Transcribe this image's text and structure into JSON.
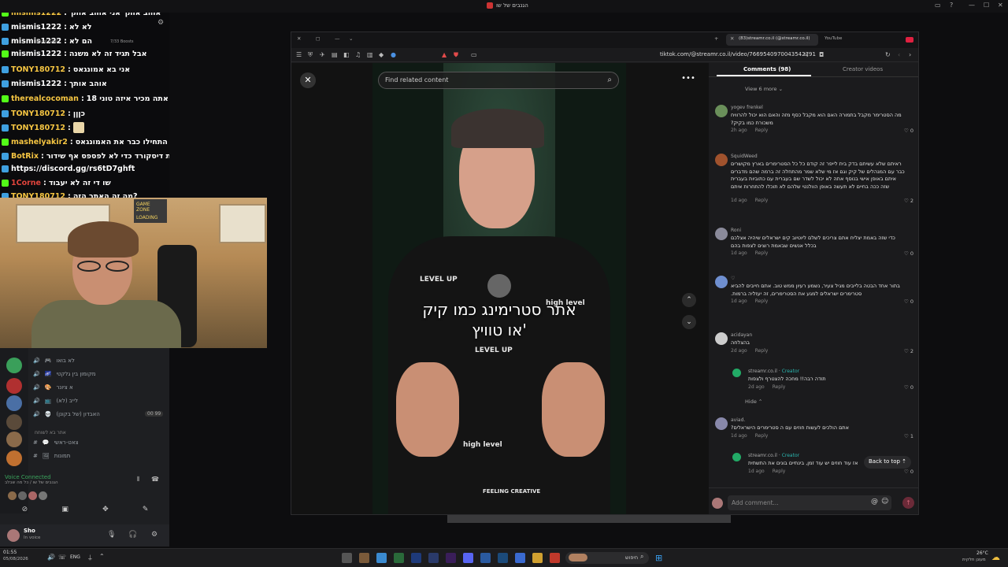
{
  "window": {
    "title": "הגנבים של שו"
  },
  "chat": {
    "messages": [
      {
        "nick": "mismis1222",
        "text": "אוהב אותך אני אוהב אותך",
        "color": "#f5c542"
      },
      {
        "nick": "mismis1222",
        "text": "לא לא",
        "color": "#ffffff"
      },
      {
        "nick": "mismis1222",
        "text": "הם לא",
        "color": "#ffffff"
      },
      {
        "nick": "mismis1222",
        "text": "אבל תגיד זה לא משנה",
        "color": "#ffffff"
      },
      {
        "nick": "TONY180712",
        "text": "אני בא אמונגאס",
        "color": "#f5c542"
      },
      {
        "nick": "mismis1222",
        "text": "אוהב אותך",
        "color": "#ffffff"
      },
      {
        "nick": "therealcocoman",
        "text": "שו אתה מכיר איזה טוני 18?",
        "color": "#f5c542"
      },
      {
        "nick": "TONY180712",
        "text": "כןןן",
        "color": "#f5c542"
      },
      {
        "nick": "TONY180712",
        "text": "",
        "color": "#f5c542"
      },
      {
        "nick": "mashelyakir2",
        "text": "התחילו כבר את האמונגאס",
        "color": "#f5c542"
      },
      {
        "nick": "BotRix",
        "text": "אם אתם נהנים מהשידורים כנסו לשרת דיסקורד כדי לא לפספס אף שידור",
        "color": "#f5c542"
      },
      {
        "nick": "",
        "text": "https://discord.gg/rs6tD7ghft",
        "color": "#ffffff"
      },
      {
        "nick": "1Corne",
        "text": "שו די זה לא יעבוד",
        "color": "#e0443c"
      },
      {
        "nick": "TONY180712",
        "text": "מה זה האתר הזה?",
        "color": "#f5c542"
      }
    ],
    "boosts": "7/33 Boosts",
    "boost_goal": "Boost Goal"
  },
  "webcam": {
    "sign": "GAME ZONE",
    "sign_sub": "LOADING"
  },
  "discord": {
    "channels": [
      {
        "name": "לא בואו",
        "emoji": "🎮"
      },
      {
        "name": "מקומון בין גלקטי",
        "emoji": "🌌"
      },
      {
        "name": "א ציונר",
        "emoji": "🎨"
      },
      {
        "name": "לייב (לא)",
        "emoji": "📺"
      },
      {
        "name": "האבדון (של בקונן)",
        "emoji": "💀"
      }
    ],
    "channel_counts": [
      "00",
      "99"
    ],
    "category": "אתר בא לשוחח",
    "text_channels": [
      {
        "name": "צאט-ראשי",
        "emoji": "💬"
      },
      {
        "name": "תמונות",
        "emoji": "🖼"
      }
    ],
    "voice_connected": "Voice Connected",
    "voice_channel": "הגנבים של שו / כל מה שבלב",
    "user": {
      "name": "Sho",
      "status": "In voice"
    }
  },
  "browser": {
    "tabs": [
      {
        "label": "(83)streamr.co.il (@streamr.co.il)"
      },
      {
        "label": "YouTube"
      }
    ],
    "url": "tiktok.com/@streamr.co.il/video/7669540970043542791"
  },
  "video": {
    "search_placeholder": "Find related content",
    "subtitle_line1": "אתר סטרימינג כמו קיק",
    "subtitle_line2": "או טוויץ'",
    "shirt_text": [
      "LEVEL UP",
      "high level",
      "LEVEL UP",
      "high level",
      "FEELING CREATIVE"
    ]
  },
  "comments": {
    "tab_comments": "Comments (98)",
    "tab_creator": "Creator videos",
    "view_more": "View 6 more",
    "items": [
      {
        "user": "yogev frenkel",
        "text": "מה הסטרימר מקבל בתמורה האם הוא מקבל כסף מזה והאם הוא יכול להרוויח משכורת כמו בקיק?",
        "time": "2h ago",
        "reply": "Reply",
        "likes": "0",
        "color": "#6a8f5a"
      },
      {
        "user": "SquidWeed",
        "text": "ראיתם שלא עשיתם בדק בית לייפר זה קודם כל כל הסטרימרים בארץ מקושרים כבר עם המנהלים של קיק וגם אז מי שלא שמר מהתחלה זה ברמה שהם מדברים איתם באופן אישי בנוסף אתה לא יכול לשדר שם בעברית עם כתוביות בעברית שזה ככה בחיים לא תעשה באופן הוולנטי שלהם לא תוכלו להתחרות איתם",
        "time": "1d ago",
        "reply": "Reply",
        "likes": "2",
        "color": "#a0522d"
      },
      {
        "user": "Roni",
        "text": "כדי שזה באמת יצליח אתם צריכים לשלם ליוטיוב קים ישראלים שיהיה אצלכם בכלל אנשים שבאמת רוצים לצפות בהם",
        "time": "1d ago",
        "reply": "Reply",
        "likes": "0",
        "color": "#8a8a9a"
      },
      {
        "user": "♡",
        "text": "בתור אחד הבטה בלייבים מגיל צעיר, נשמע רעיון ממש טוב. אתם חייבים להביא סטרימרים ישראלים למגע את הסטרימרים, זה יעזליה ברמות.",
        "time": "1d ago",
        "reply": "Reply",
        "likes": "0",
        "color": "#6f8fd0"
      },
      {
        "user": "acidayan",
        "text": "בהצלחה",
        "time": "2d ago",
        "reply": "Reply",
        "likes": "2",
        "color": "#cccccc"
      },
      {
        "user": "streamr.co.il",
        "creator": "Creator",
        "text": "תודה רבה!! מחכה להצטרף ולצפות",
        "time": "2d ago",
        "reply": "Reply",
        "likes": "0",
        "color": "#22aa66"
      },
      {
        "user": "aviad.",
        "text": "אתם הולכים לעשות חוזים עם ה סטרימרים הישראלים?",
        "time": "1d ago",
        "reply": "Reply",
        "likes": "1",
        "color": "#8888aa"
      },
      {
        "user": "streamr.co.il",
        "creator": "Creator",
        "text": "אז עוד חוזים יש עוד זמן, בינתיים בונים את התשתית",
        "time": "1d ago",
        "reply": "Reply",
        "likes": "0",
        "color": "#22aa66"
      }
    ],
    "hide": "Hide",
    "back_to_top": "Back to top",
    "add_placeholder": "Add comment..."
  },
  "taskbar": {
    "time": "01:55",
    "date": "05/08/2026",
    "lang": "ENG",
    "search": "חיפוש",
    "weather_temp": "26°C",
    "weather_text": "מעונן חלקית"
  }
}
